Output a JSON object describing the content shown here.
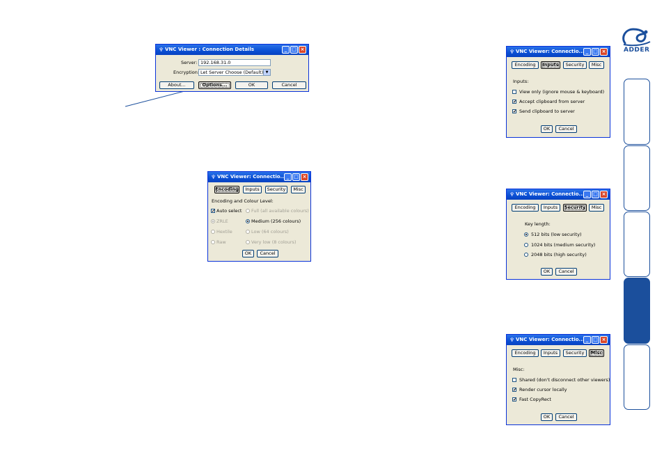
{
  "brand": {
    "logo_text": "ADDER",
    "color": "#1b4f9c"
  },
  "side_tabs": [
    {
      "active": false
    },
    {
      "active": false
    },
    {
      "active": false
    },
    {
      "active": true
    },
    {
      "active": false
    }
  ],
  "conn": {
    "title": "VNC Viewer : Connection Details",
    "server_label": "Server:",
    "server_value": "192.168.31.0",
    "encryption_label": "Encryption:",
    "encryption_value": "Let Server Choose (Default)",
    "about": "About...",
    "options": "Options...",
    "ok": "OK",
    "cancel": "Cancel"
  },
  "tabs": {
    "encoding": "Encoding",
    "inputs": "Inputs",
    "security": "Security",
    "misc": "Misc"
  },
  "truncated_title": "VNC Viewer: Connectio...",
  "ok": "OK",
  "cancel": "Cancel",
  "enc": {
    "heading": "Encoding and Colour Level:",
    "auto_select": "Auto select",
    "full": "Full (all available colours)",
    "zrle": "ZRLE",
    "medium": "Medium (256 colours)",
    "hextile": "Hextile",
    "low": "Low (64 colours)",
    "raw": "Raw",
    "verylow": "Very low (8 colours)"
  },
  "inp": {
    "heading": "Inputs:",
    "view_only": "View only (ignore mouse & keyboard)",
    "accept_clip": "Accept clipboard from server",
    "send_clip": "Send clipboard to server"
  },
  "sec": {
    "heading": "Key length:",
    "k512": "512 bits (low security)",
    "k1024": "1024 bits (medium security)",
    "k2048": "2048 bits (high security)"
  },
  "misc": {
    "heading": "Misc:",
    "shared": "Shared (don't disconnect other viewers)",
    "render_cursor": "Render cursor locally",
    "fast_copy": "Fast CopyRect"
  },
  "icons": {
    "window": "vnc-window-icon",
    "minimize": "minimize-icon",
    "maximize": "maximize-icon",
    "close": "close-icon",
    "check": "✔"
  }
}
